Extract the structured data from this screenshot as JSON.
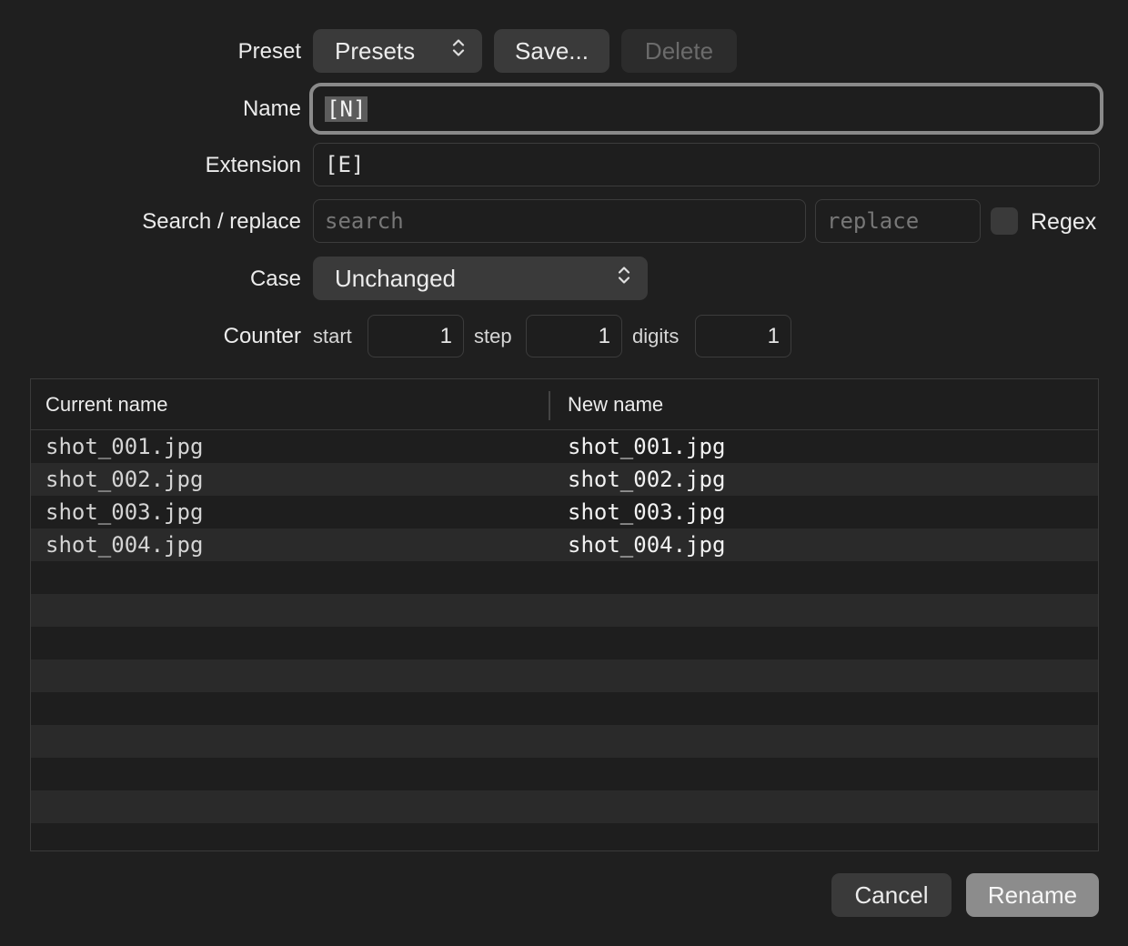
{
  "preset": {
    "label": "Preset",
    "popup_value": "Presets",
    "save_label": "Save...",
    "delete_label": "Delete"
  },
  "name": {
    "label": "Name",
    "value": "[N]"
  },
  "extension": {
    "label": "Extension",
    "value": "[E]"
  },
  "search_replace": {
    "label": "Search / replace",
    "search_placeholder": "search",
    "replace_placeholder": "replace",
    "regex_label": "Regex",
    "regex_checked": false
  },
  "case": {
    "label": "Case",
    "value": "Unchanged"
  },
  "counter": {
    "label": "Counter",
    "start_label": "start",
    "start_value": "1",
    "step_label": "step",
    "step_value": "1",
    "digits_label": "digits",
    "digits_value": "1"
  },
  "table": {
    "headers": [
      "Current name",
      "New name"
    ],
    "rows": [
      {
        "current": "shot_001.jpg",
        "new": "shot_001.jpg"
      },
      {
        "current": "shot_002.jpg",
        "new": "shot_002.jpg"
      },
      {
        "current": "shot_003.jpg",
        "new": "shot_003.jpg"
      },
      {
        "current": "shot_004.jpg",
        "new": "shot_004.jpg"
      }
    ]
  },
  "footer": {
    "cancel_label": "Cancel",
    "rename_label": "Rename"
  },
  "colors": {
    "background": "#1f1f1f",
    "button": "#3a3a3a",
    "rename_button": "#8c8c8c",
    "focus_ring": "#8a8a8a"
  },
  "icons": {
    "popup_chevron": "chevron-up-down-icon"
  }
}
